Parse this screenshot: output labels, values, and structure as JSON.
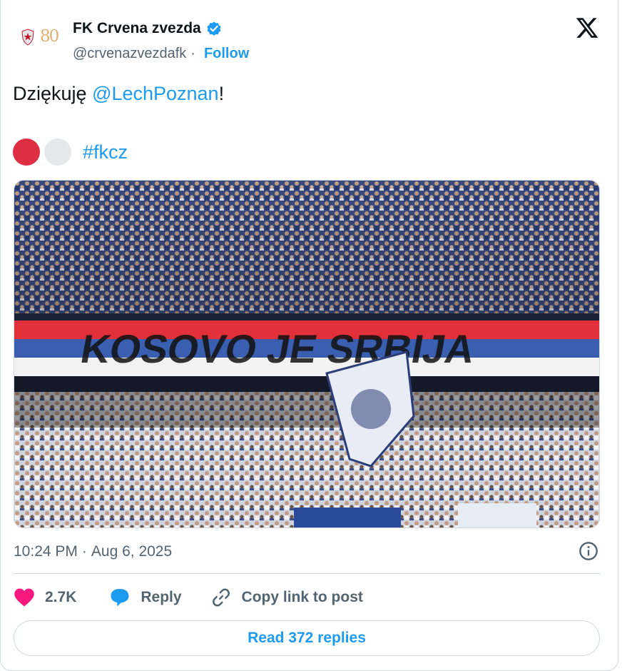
{
  "author": {
    "name": "FK Crvena zvezda",
    "handle": "@crvenazvezdafk",
    "separator": "·",
    "follow_label": "Follow",
    "avatar_number": "80",
    "verified": true,
    "avatar_icon": "crvena-zvezda-crest-icon"
  },
  "post": {
    "text_prefix": "Dziękuję ",
    "mention": "@LechPoznan",
    "text_suffix": "!",
    "hashtag": "#fkcz",
    "emoji": [
      "red-circle",
      "white-circle"
    ],
    "photo_banner_text": "KOSOVO JE SRBIJA",
    "photo_description_icon": "stadium-crowd-photo"
  },
  "meta": {
    "time": "10:24 PM",
    "separator": "·",
    "date": "Aug 6, 2025",
    "info_icon": "info-icon"
  },
  "actions": {
    "likes_count": "2.7K",
    "reply_label": "Reply",
    "copy_label": "Copy link to post",
    "read_replies_label": "Read 372 replies"
  },
  "colors": {
    "accent": "#1d9bf0",
    "like": "#f91880",
    "text_primary": "#0f1419",
    "text_secondary": "#536471",
    "border": "#cfd9de"
  }
}
